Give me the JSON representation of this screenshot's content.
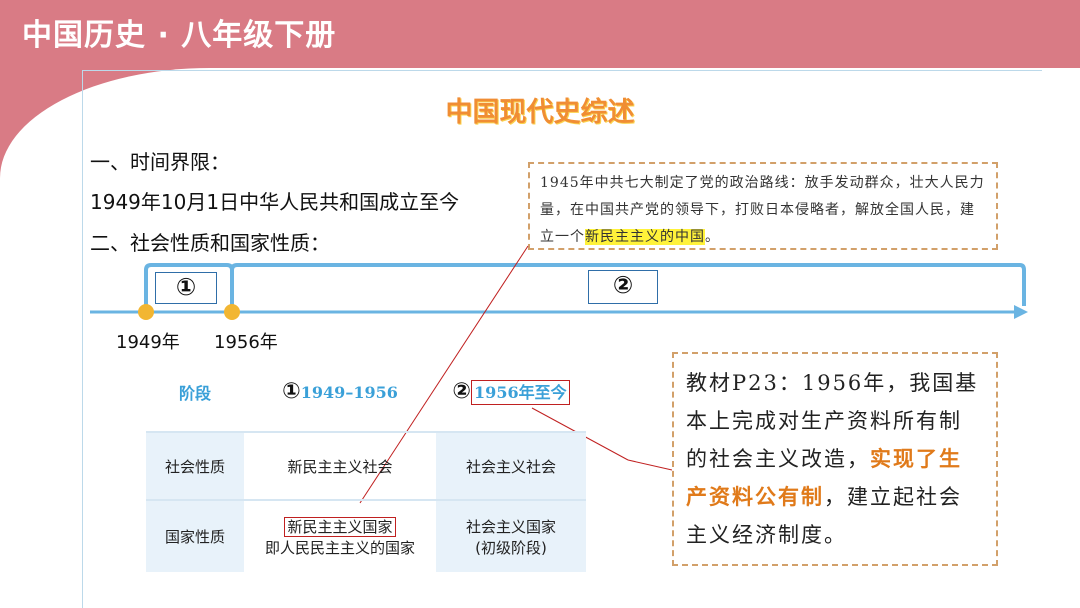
{
  "header": {
    "title": "中国历史 · 八年级下册"
  },
  "main": {
    "title": "中国现代史综述"
  },
  "section1": {
    "heading": "一、时间界限：",
    "content": "1949年10月1日中华人民共和国成立至今"
  },
  "section2": {
    "heading": "二、社会性质和国家性质："
  },
  "quote": {
    "text_before": "1945年中共七大制定了党的政治路线：放手发动群众，壮大人民力量，在中国共产党的领导下，打败日本侵略者，解放全国人民，建立一个",
    "highlight": "新民主主义的中国",
    "text_after": "。"
  },
  "timeline": {
    "stage1_label": "①",
    "stage2_label": "②",
    "year1": "1949年",
    "year2": "1956年",
    "colors": {
      "line": "#6ab4e2",
      "dot": "#f2b632"
    }
  },
  "table": {
    "header_stage": "阶段",
    "col1_num": "①",
    "col1_period": "1949–1956",
    "col2_num": "②",
    "col2_period": "1956年至今",
    "row1_label": "社会性质",
    "row1_col1": "新民主主义社会",
    "row1_col2": "社会主义社会",
    "row2_label": "国家性质",
    "row2_col1_boxed": "新民主主义国家",
    "row2_col1_sub": "即人民民主主义的国家",
    "row2_col2_line1": "社会主义国家",
    "row2_col2_line2": "(初级阶段)"
  },
  "textbook": {
    "text_before": "教材P23：1956年，我国基本上完成对生产资料所有制的社会主义改造，",
    "highlight": "实现了生产资料公有制",
    "text_after": "，建立起社会主义经济制度。"
  }
}
